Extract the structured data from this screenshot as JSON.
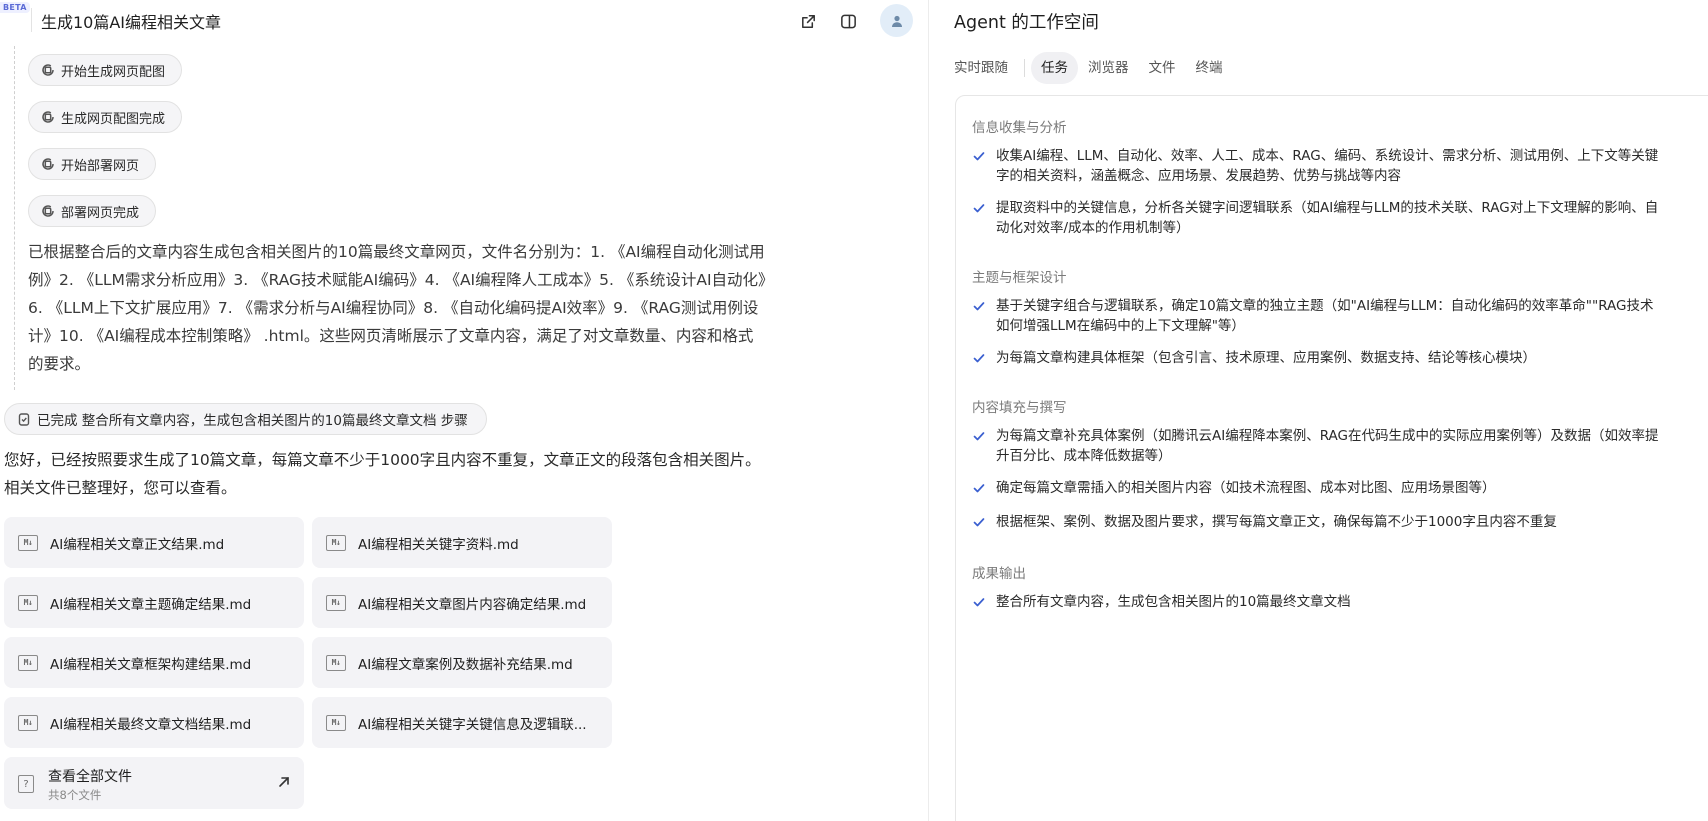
{
  "header": {
    "beta_label": "BETA",
    "chat_title": "生成10篇AI编程相关文章"
  },
  "steps": [
    {
      "label": "开始生成网页配图"
    },
    {
      "label": "生成网页配图完成"
    },
    {
      "label": "开始部署网页"
    },
    {
      "label": "部署网页完成"
    }
  ],
  "result_paragraph": "已根据整合后的文章内容生成包含相关图片的10篇最终文章网页，文件名分别为：1. 《AI编程自动化测试用例》2. 《LLM需求分析应用》3. 《RAG技术赋能AI编码》4. 《AI编程降人工成本》5. 《系统设计AI自动化》6. 《LLM上下文扩展应用》7. 《需求分析与AI编程协同》8. 《自动化编码提AI效率》9. 《RAG测试用例设计》10. 《AI编程成本控制策略》 .html。这些网页清晰展示了文章内容，满足了对文章数量、内容和格式的要求。",
  "completed_step": "已完成 整合所有文章内容，生成包含相关图片的10篇最终文章文档 步骤",
  "final_message": "您好，已经按照要求生成了10篇文章，每篇文章不少于1000字且内容不重复，文章正文的段落包含相关图片。相关文件已整理好，您可以查看。",
  "files": [
    {
      "icon": "M↓",
      "name": "AI编程相关文章正文结果.md"
    },
    {
      "icon": "M↓",
      "name": "AI编程相关关键字资料.md"
    },
    {
      "icon": "M↓",
      "name": "AI编程相关文章主题确定结果.md"
    },
    {
      "icon": "M↓",
      "name": "AI编程相关文章图片内容确定结果.md"
    },
    {
      "icon": "M↓",
      "name": "AI编程相关文章框架构建结果.md"
    },
    {
      "icon": "M↓",
      "name": "AI编程文章案例及数据补充结果.md"
    },
    {
      "icon": "M↓",
      "name": "AI编程相关最终文章文档结果.md"
    },
    {
      "icon": "M↓",
      "name": "AI编程相关关键字关键信息及逻辑联..."
    }
  ],
  "view_all": {
    "icon": "?",
    "label": "查看全部文件",
    "count": "共8个文件"
  },
  "workspace": {
    "title": "Agent 的工作空间",
    "tabs": [
      "实时跟随",
      "任务",
      "浏览器",
      "文件",
      "终端"
    ],
    "active_tab": "任务",
    "sections": [
      {
        "label": "信息收集与分析",
        "tasks": [
          "收集AI编程、LLM、自动化、效率、人工、成本、RAG、编码、系统设计、需求分析、测试用例、上下文等关键字的相关资料，涵盖概念、应用场景、发展趋势、优势与挑战等内容",
          "提取资料中的关键信息，分析各关键字间逻辑联系（如AI编程与LLM的技术关联、RAG对上下文理解的影响、自动化对效率/成本的作用机制等）"
        ]
      },
      {
        "label": "主题与框架设计",
        "tasks": [
          "基于关键字组合与逻辑联系，确定10篇文章的独立主题（如\"AI编程与LLM：自动化编码的效率革命\"\"RAG技术如何增强LLM在编码中的上下文理解\"等）",
          "为每篇文章构建具体框架（包含引言、技术原理、应用案例、数据支持、结论等核心模块）"
        ]
      },
      {
        "label": "内容填充与撰写",
        "tasks": [
          "为每篇文章补充具体案例（如腾讯云AI编程降本案例、RAG在代码生成中的实际应用案例等）及数据（如效率提升百分比、成本降低数据等）",
          "确定每篇文章需插入的相关图片内容（如技术流程图、成本对比图、应用场景图等）",
          "根据框架、案例、数据及图片要求，撰写每篇文章正文，确保每篇不少于1000字且内容不重复"
        ]
      },
      {
        "label": "成果输出",
        "tasks": [
          "整合所有文章内容，生成包含相关图片的10篇最终文章文档"
        ]
      }
    ]
  },
  "colors": {
    "accent": "#3a5fd0",
    "pill_bg": "#f5f5f7",
    "card_bg": "#f3f3f6",
    "avatar_bg": "#e2edf8"
  }
}
